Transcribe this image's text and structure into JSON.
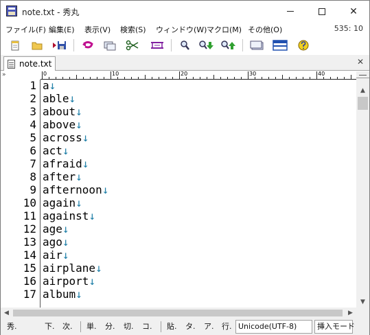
{
  "window": {
    "title": "note.txt - 秀丸",
    "minimize_symbol": "",
    "close_symbol": "✕"
  },
  "menubar": {
    "items": [
      {
        "label": "ファイル(F)"
      },
      {
        "label": "編集(E)"
      },
      {
        "label": "表示(V)"
      },
      {
        "label": "検索(S)"
      },
      {
        "label": "ウィンドウ(W)"
      },
      {
        "label": "マクロ(M)"
      },
      {
        "label": "その他(O)"
      }
    ],
    "cursor_position": "535: 10"
  },
  "toolbar": {
    "buttons": [
      {
        "icon": "new-file-icon"
      },
      {
        "icon": "open-folder-icon"
      },
      {
        "icon": "save-icon"
      },
      {
        "icon": "undo-icon"
      },
      {
        "icon": "copy-icon"
      },
      {
        "icon": "cut-icon"
      },
      {
        "icon": "paste-icon"
      },
      {
        "icon": "search-icon"
      },
      {
        "icon": "search-next-icon"
      },
      {
        "icon": "search-prev-icon"
      },
      {
        "icon": "window-icon"
      },
      {
        "icon": "split-window-icon"
      },
      {
        "icon": "help-icon"
      }
    ]
  },
  "tabs": {
    "items": [
      {
        "label": "note.txt"
      }
    ],
    "close_symbol": "✕"
  },
  "ruler": {
    "corner_label": "»",
    "labels": [
      "0",
      "10",
      "20",
      "30",
      "40"
    ]
  },
  "editor": {
    "eol_mark": "↓",
    "lines": [
      {
        "no": "1",
        "text": "a"
      },
      {
        "no": "2",
        "text": "able"
      },
      {
        "no": "3",
        "text": "about"
      },
      {
        "no": "4",
        "text": "above"
      },
      {
        "no": "5",
        "text": "across"
      },
      {
        "no": "6",
        "text": "act"
      },
      {
        "no": "7",
        "text": "afraid"
      },
      {
        "no": "8",
        "text": "after"
      },
      {
        "no": "9",
        "text": "afternoon"
      },
      {
        "no": "10",
        "text": "again"
      },
      {
        "no": "11",
        "text": "against"
      },
      {
        "no": "12",
        "text": "age"
      },
      {
        "no": "13",
        "text": "ago"
      },
      {
        "no": "14",
        "text": "air"
      },
      {
        "no": "15",
        "text": "airplane"
      },
      {
        "no": "16",
        "text": "airport"
      },
      {
        "no": "17",
        "text": "album"
      }
    ]
  },
  "scrollbars": {
    "up": "▲",
    "down": "▼",
    "left": "◀",
    "right": "▶"
  },
  "fkeys": {
    "groups": [
      [
        "秀.",
        "",
        "下.",
        "次."
      ],
      [
        "単.",
        "分.",
        "切.",
        "コ."
      ],
      [
        "貼.",
        "タ.",
        "ア.",
        "行."
      ]
    ],
    "encoding": "Unicode(UTF-8)",
    "mode": "挿入モード"
  }
}
